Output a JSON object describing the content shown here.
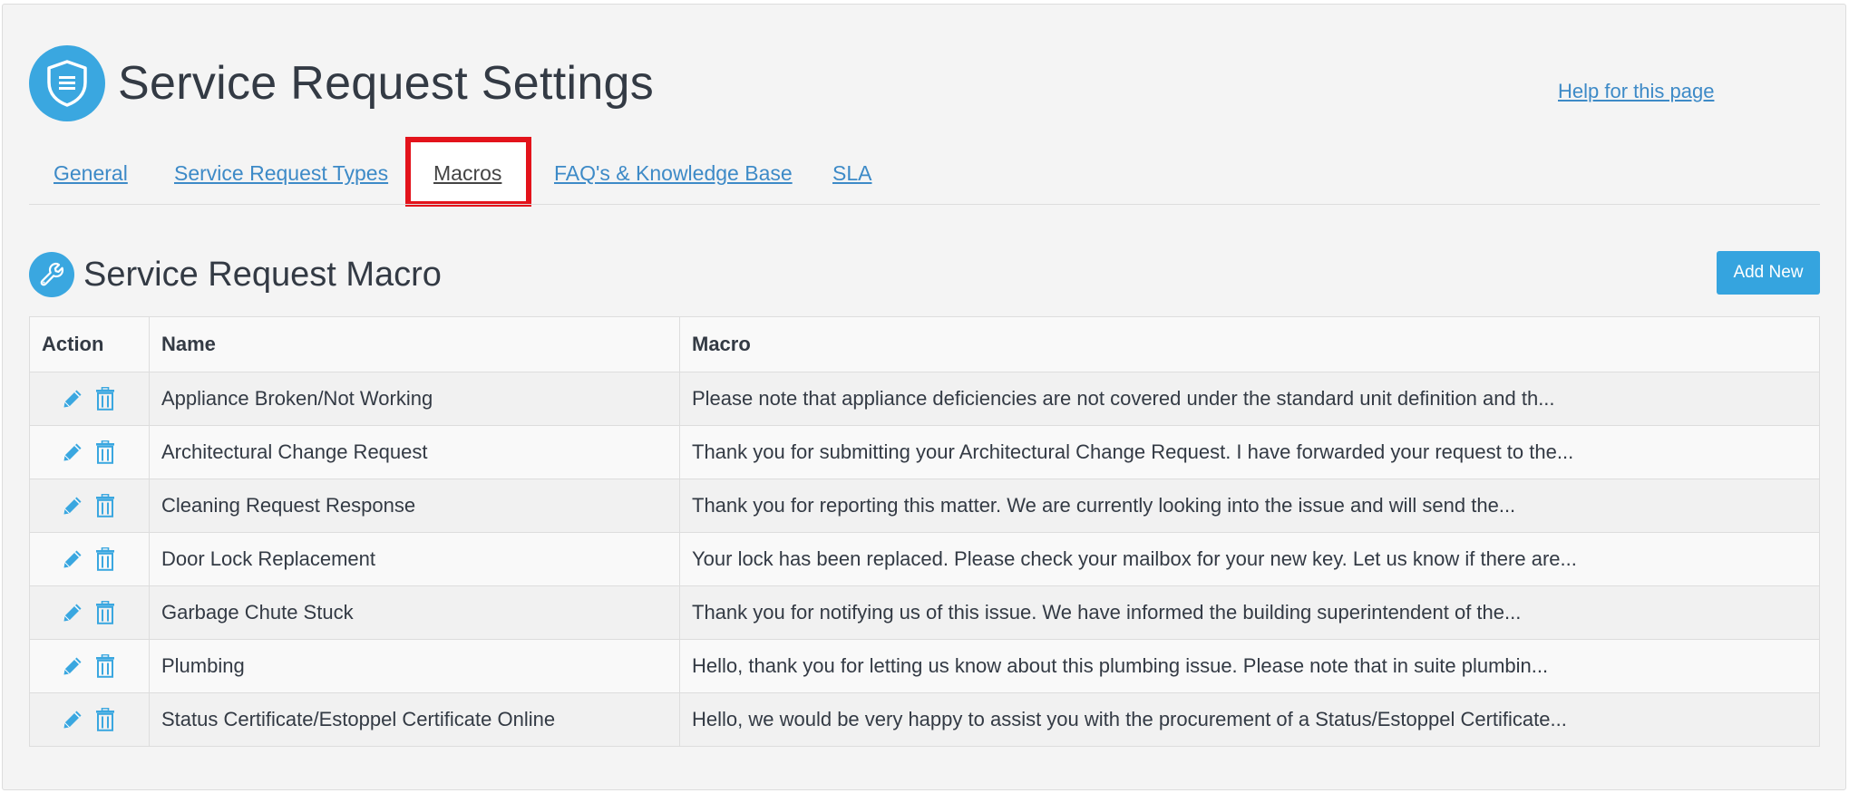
{
  "header": {
    "title": "Service Request Settings",
    "help_link": "Help for this page",
    "icon": "shield-icon"
  },
  "tabs": [
    {
      "label": "General",
      "active": false
    },
    {
      "label": "Service Request Types",
      "active": false
    },
    {
      "label": "Macros",
      "active": true
    },
    {
      "label": "FAQ's & Knowledge Base",
      "active": false
    },
    {
      "label": "SLA",
      "active": false
    }
  ],
  "section": {
    "title": "Service Request Macro",
    "icon": "wrench-icon",
    "add_button": "Add New"
  },
  "table": {
    "columns": [
      "Action",
      "Name",
      "Macro"
    ],
    "rows": [
      {
        "name": "Appliance Broken/Not Working",
        "macro": "Please note that appliance deficiencies are not covered under the standard unit definition and th..."
      },
      {
        "name": "Architectural Change Request",
        "macro": "Thank you for submitting your Architectural Change Request. I have forwarded your request to the..."
      },
      {
        "name": "Cleaning Request Response",
        "macro": "Thank you for reporting this matter. We are currently looking into the issue and will send the..."
      },
      {
        "name": "Door Lock Replacement",
        "macro": "Your lock has been replaced. Please check your mailbox for your new key. Let us know if there are..."
      },
      {
        "name": "Garbage Chute Stuck",
        "macro": "Thank you for notifying us of this issue. We have informed the building superintendent of the..."
      },
      {
        "name": "Plumbing",
        "macro": "Hello, thank you for letting us know about this plumbing issue. Please note that in suite plumbin..."
      },
      {
        "name": "Status Certificate/Estoppel Certificate Online",
        "macro": "Hello, we would be very happy to assist you with the procurement of a Status/Estoppel Certificate..."
      }
    ]
  },
  "colors": {
    "accent": "#3aa7e0",
    "link": "#3d8ac7",
    "highlight": "#e3131b"
  }
}
